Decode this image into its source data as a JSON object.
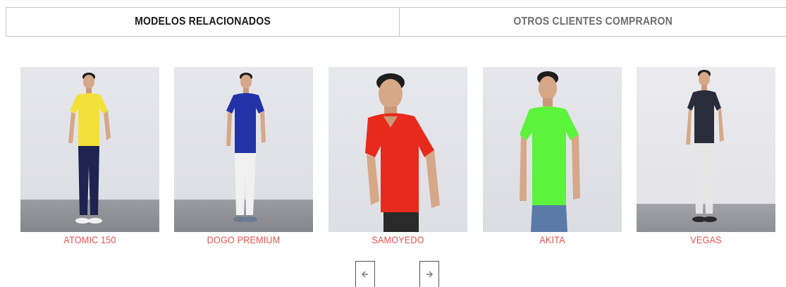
{
  "tabs": [
    {
      "label": "MODELOS  RELACIONADOS",
      "active": true
    },
    {
      "label": "OTROS CLIENTES COMPRARON",
      "active": false
    }
  ],
  "products": [
    {
      "name": "ATOMIC 150",
      "shirt_color": "#f3e03a",
      "pants_color": "#1e2350"
    },
    {
      "name": "DOGO PREMIUM",
      "shirt_color": "#2233a8",
      "pants_color": "#f1f1f1"
    },
    {
      "name": "SAMOYEDO",
      "shirt_color": "#e82a1c",
      "pants_color": "#2a2a2a"
    },
    {
      "name": "AKITA",
      "shirt_color": "#5cf33c",
      "pants_color": "#5a7aa8"
    },
    {
      "name": "VEGAS",
      "shirt_color": "#2a2c3c",
      "pants_color": "#e6e6e6"
    }
  ],
  "colors": {
    "product_name": "#e8534f",
    "tab_border": "#c8c8c8"
  },
  "nav": {
    "prev_icon": "arrow-left-icon",
    "next_icon": "arrow-right-icon"
  }
}
